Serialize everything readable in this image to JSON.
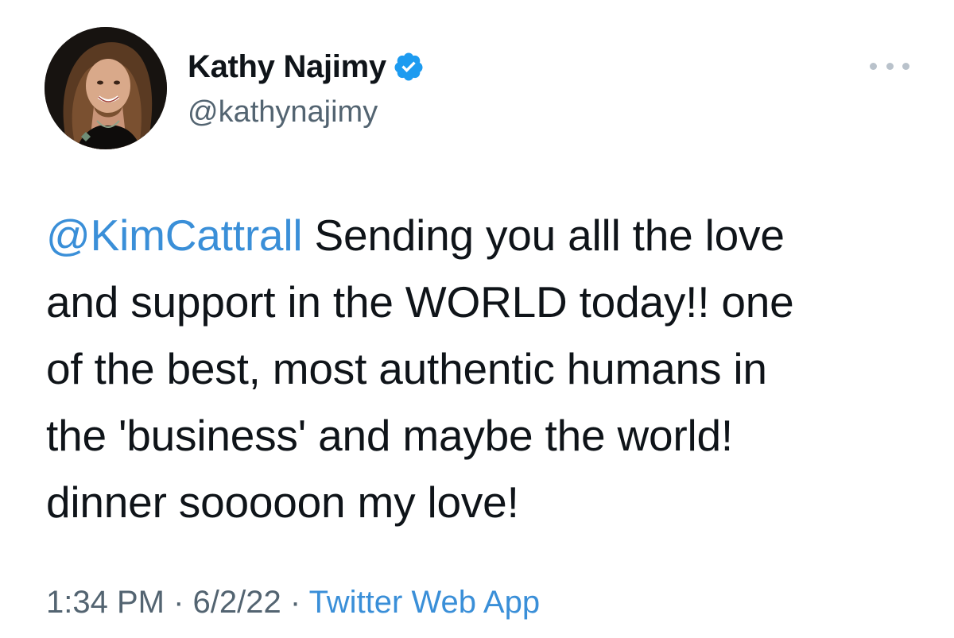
{
  "author": {
    "display_name": "Kathy Najimy",
    "handle": "@kathynajimy",
    "verified": true,
    "avatar_icon": "profile-photo"
  },
  "tweet": {
    "mention": "@KimCattrall",
    "lines": [
      " Sending you alll the love",
      "and support in the WORLD today!! one",
      "of the best, most authentic humans in",
      "the 'business' and maybe the world!",
      "dinner sooooon my love!"
    ]
  },
  "meta": {
    "time": "1:34 PM",
    "separator": " · ",
    "date": "6/2/22",
    "source": "Twitter Web App"
  },
  "colors": {
    "link": "#3a8fd8",
    "verified": "#1d9bf0",
    "secondary_text": "#536471",
    "primary_text": "#0f1419"
  },
  "icons": {
    "verified": "verified-badge-icon",
    "more": "more-options-icon"
  }
}
